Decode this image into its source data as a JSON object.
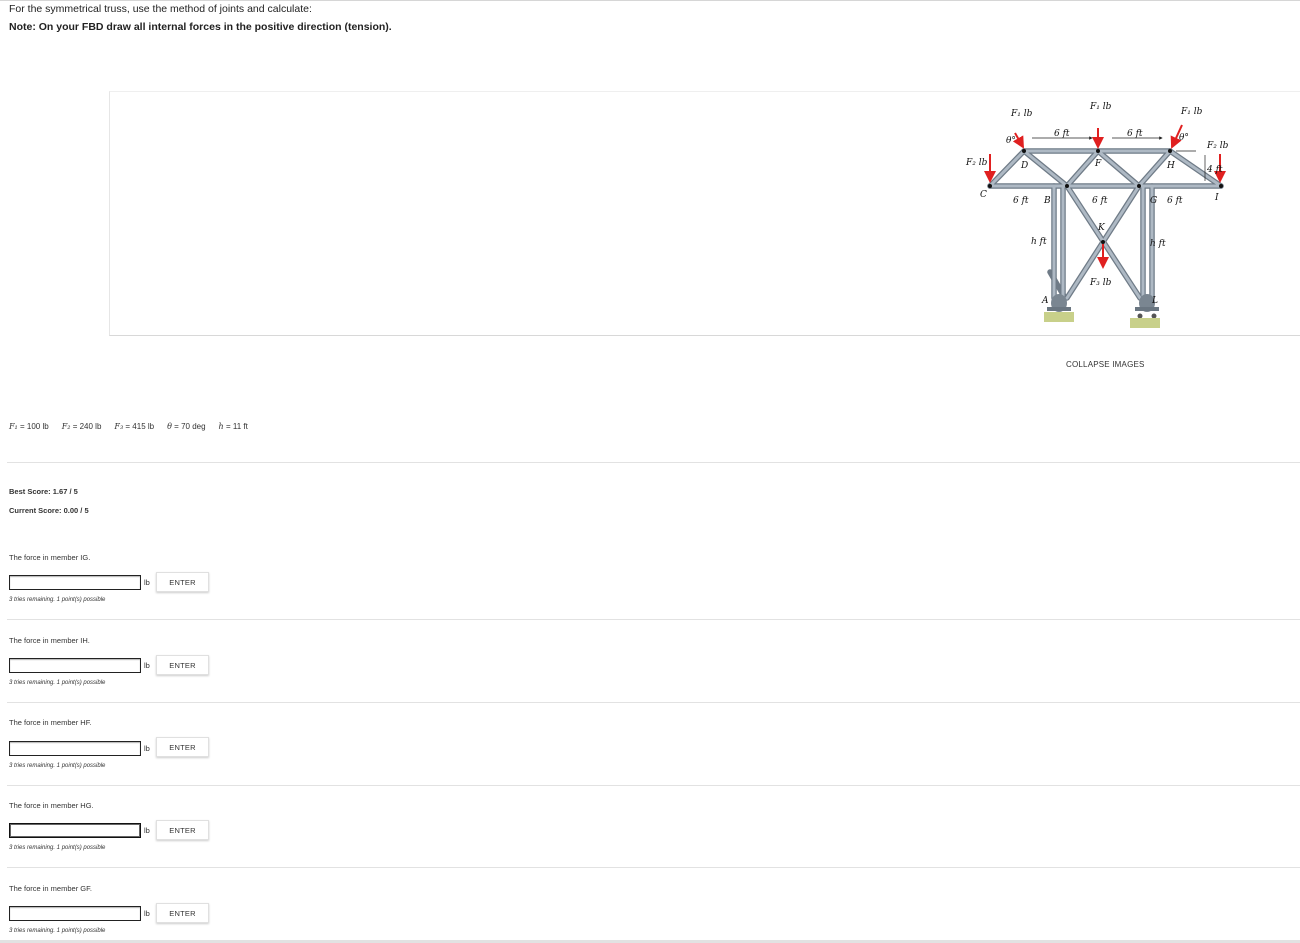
{
  "intro": {
    "line1": "For the symmetrical truss, use the method of joints and calculate:",
    "line2": "Note: On your FBD draw all internal forces in the positive direction (tension)."
  },
  "figure": {
    "labels": {
      "f1_left": "F₁ lb",
      "f1_mid": "F₁ lb",
      "f1_right": "F₁ lb",
      "f2_left": "F₂ lb",
      "f2_right": "F₂ lb",
      "f3": "F₃ lb",
      "theta_left": "θ°",
      "theta_right": "θ°",
      "dim_top_left": "6 ft",
      "dim_top_right": "6 ft",
      "dim_bot_left": "6 ft",
      "dim_bot_mid": "6 ft",
      "dim_bot_right": "6 ft",
      "dim_height": "4 ft",
      "h_left": "h ft",
      "h_right": "h ft",
      "A": "A",
      "B": "B",
      "C": "C",
      "D": "D",
      "F": "F",
      "G": "G",
      "H": "H",
      "I": "I",
      "K": "K",
      "L": "L"
    },
    "colors": {
      "member": "#9aa6b2",
      "member_edge": "#6f7b87",
      "force_arrow": "#e02020",
      "support": "#7a8691",
      "ground": "#c8d08a"
    }
  },
  "collapse_label": "COLLAPSE IMAGES",
  "givens": {
    "f1_sym": "F₁",
    "f1_val": "= 100 lb",
    "f2_sym": "F₂",
    "f2_val": "= 240 lb",
    "f3_sym": "F₃",
    "f3_val": "= 415 lb",
    "theta_sym": "θ",
    "theta_val": "= 70 deg",
    "h_sym": "h",
    "h_val": "= 11 ft"
  },
  "scores": {
    "best": "Best Score: 1.67 / 5",
    "current": "Current Score: 0.00 / 5"
  },
  "questions": [
    {
      "label": "The force in member IG.",
      "value": "",
      "unit": "lb",
      "button": "ENTER",
      "tries": "3 tries remaining. 1 point(s) possible"
    },
    {
      "label": "The force in member IH.",
      "value": "",
      "unit": "lb",
      "button": "ENTER",
      "tries": "3 tries remaining. 1 point(s) possible"
    },
    {
      "label": "The force in member HF.",
      "value": "",
      "unit": "lb",
      "button": "ENTER",
      "tries": "3 tries remaining. 1 point(s) possible"
    },
    {
      "label": "The force in member HG.",
      "value": "",
      "unit": "lb",
      "button": "ENTER",
      "tries": "3 tries remaining. 1 point(s) possible"
    },
    {
      "label": "The force in member GF.",
      "value": "",
      "unit": "lb",
      "button": "ENTER",
      "tries": "3 tries remaining. 1 point(s) possible"
    }
  ]
}
